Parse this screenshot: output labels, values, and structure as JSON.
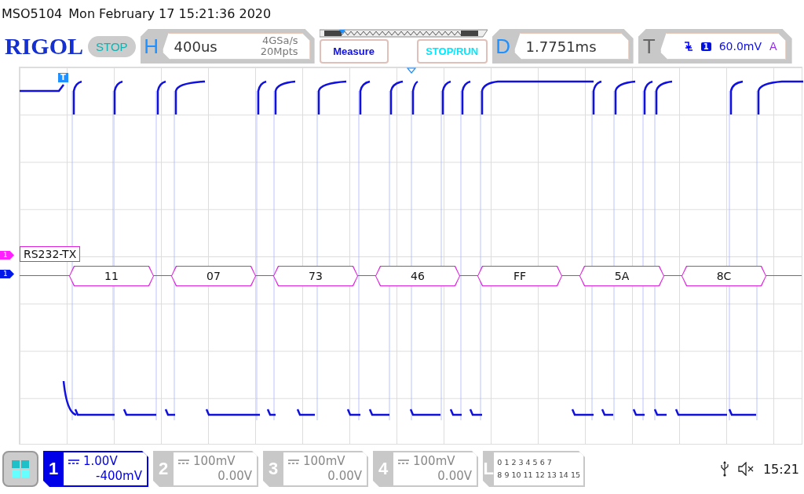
{
  "header": {
    "model": "MSO5104",
    "datetime": "Mon February 17 15:21:36 2020"
  },
  "toolbar": {
    "logo": "RIGOL",
    "run_status": "STOP",
    "horizontal": {
      "letter": "H",
      "timebase": "400us",
      "sample_rate": "4GSa/s",
      "memory_depth": "20Mpts"
    },
    "buttons": [
      "Measure",
      "STOP/RUN"
    ],
    "delay": {
      "letter": "D",
      "value": "1.7751ms"
    },
    "trigger": {
      "letter": "T",
      "source": "1",
      "level": "60.0mV",
      "mode": "A"
    }
  },
  "waveform": {
    "trigger_marker": "T",
    "decoder": {
      "channel": "1",
      "label": "RS232-TX",
      "bytes": [
        "11",
        "07",
        "73",
        "46",
        "FF",
        "5A",
        "8C"
      ]
    },
    "channel_marker": "1"
  },
  "channels": [
    {
      "number": "1",
      "scale": "1.00V",
      "offset": "-400mV",
      "enabled": true
    },
    {
      "number": "2",
      "scale": "100mV",
      "offset": "0.00V",
      "enabled": false
    },
    {
      "number": "3",
      "scale": "100mV",
      "offset": "0.00V",
      "enabled": false
    },
    {
      "number": "4",
      "scale": "100mV",
      "offset": "0.00V",
      "enabled": false
    }
  ],
  "logic": {
    "letter": "L",
    "bits_row1": [
      "0",
      "1",
      "2",
      "3",
      "4",
      "5",
      "6",
      "7"
    ],
    "bits_row2": [
      "8",
      "9",
      "10",
      "11",
      "12",
      "13",
      "14",
      "15"
    ]
  },
  "status": {
    "time": "15:21"
  }
}
